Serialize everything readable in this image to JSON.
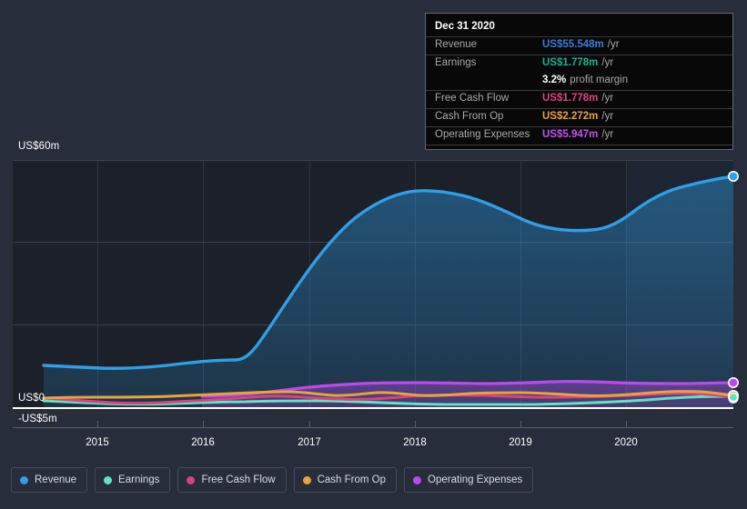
{
  "chart_data": {
    "type": "area",
    "title": "",
    "xlabel": "",
    "ylabel": "",
    "x_tick_labels": [
      "2015",
      "2016",
      "2017",
      "2018",
      "2019",
      "2020"
    ],
    "y_tick_labels": [
      "US$60m",
      "US$0",
      "-US$5m"
    ],
    "ylim": [
      -5,
      60
    ],
    "xlim": [
      2014.5,
      2021.0
    ],
    "grid": true,
    "legend_position": "bottom-left",
    "units": "US$ millions per year",
    "series": [
      {
        "name": "Revenue",
        "color": "#2e9fe8",
        "x": [
          2014.6,
          2014.9,
          2015.2,
          2015.5,
          2015.8,
          2016.0,
          2016.25,
          2016.5,
          2016.75,
          2017.0,
          2017.25,
          2017.5,
          2017.75,
          2018.0,
          2018.25,
          2018.5,
          2018.75,
          2019.0,
          2019.25,
          2019.5,
          2019.75,
          2020.0,
          2020.3,
          2020.6,
          2020.95
        ],
        "values": [
          9.6,
          9.3,
          9.0,
          9.2,
          9.6,
          10.0,
          10.4,
          10.5,
          14.5,
          22.5,
          31.0,
          38.5,
          44.0,
          47.0,
          46.3,
          45.6,
          43.4,
          40.0,
          37.4,
          37.2,
          39.3,
          44.6,
          48.0,
          49.6,
          52.6
        ]
      },
      {
        "name": "Earnings",
        "color": "#5fe3c0",
        "x": [
          2014.6,
          2015.0,
          2015.4,
          2015.8,
          2016.2,
          2016.6,
          2017.0,
          2017.4,
          2017.8,
          2018.2,
          2018.6,
          2019.0,
          2019.4,
          2019.8,
          2020.2,
          2020.6,
          2020.95
        ],
        "values": [
          -0.55,
          -0.75,
          -0.9,
          -0.95,
          -0.9,
          -0.75,
          -0.7,
          -0.85,
          -0.9,
          -0.85,
          -0.95,
          -1.0,
          -0.95,
          -0.8,
          -0.3,
          0.4,
          0.8
        ]
      },
      {
        "name": "Free Cash Flow",
        "color": "#d6447f",
        "x": [
          2014.6,
          2015.0,
          2015.4,
          2015.8,
          2016.2,
          2016.6,
          2017.0,
          2017.4,
          2017.8,
          2018.2,
          2018.6,
          2019.0,
          2019.4,
          2019.8,
          2020.2,
          2020.6,
          2020.95
        ],
        "values": [
          0.3,
          0.1,
          -0.55,
          -0.75,
          -0.55,
          -0.3,
          0.1,
          0.55,
          0.4,
          0.1,
          0.9,
          1.1,
          0.9,
          0.7,
          1.0,
          1.5,
          1.1
        ]
      },
      {
        "name": "Cash From Op",
        "color": "#e8a33d",
        "x": [
          2014.6,
          2015.0,
          2015.4,
          2015.8,
          2016.2,
          2016.6,
          2017.0,
          2017.4,
          2017.8,
          2018.2,
          2018.6,
          2019.0,
          2019.4,
          2019.8,
          2020.2,
          2020.6,
          2020.95
        ],
        "values": [
          0.45,
          0.6,
          0.55,
          0.5,
          0.75,
          0.95,
          1.35,
          0.8,
          1.3,
          0.7,
          1.15,
          1.2,
          0.85,
          0.8,
          1.2,
          1.7,
          1.5
        ]
      },
      {
        "name": "Operating Expenses",
        "color": "#bb4aea",
        "x": [
          2015.95,
          2016.3,
          2016.7,
          2017.1,
          2017.5,
          2017.9,
          2018.3,
          2018.7,
          2019.1,
          2019.5,
          2019.9,
          2020.3,
          2020.7,
          2020.95
        ],
        "values": [
          1.6,
          1.65,
          2.3,
          3.1,
          3.4,
          3.7,
          4.0,
          3.8,
          3.75,
          4.2,
          3.95,
          3.95,
          4.1,
          4.2
        ]
      }
    ],
    "end_markers": [
      {
        "series": "Revenue",
        "value": 55.548
      },
      {
        "series": "Operating Expenses",
        "value": 5.947
      },
      {
        "series": "Cash From Op",
        "value": 2.272
      },
      {
        "series": "Free Cash Flow",
        "value": 1.778
      },
      {
        "series": "Earnings",
        "value": 1.778
      }
    ]
  },
  "tooltip": {
    "date": "Dec 31 2020",
    "rows": [
      {
        "key": "Revenue",
        "value": "US$55.548m",
        "unit": "/yr",
        "color": "#3b7ddd",
        "rule": true
      },
      {
        "key": "Earnings",
        "value": "US$1.778m",
        "unit": "/yr",
        "color": "#19b394",
        "rule": true
      },
      {
        "key": "",
        "value": "3.2%",
        "unit": "profit margin",
        "color": "#ffffff",
        "rule": false
      },
      {
        "key": "Free Cash Flow",
        "value": "US$1.778m",
        "unit": "/yr",
        "color": "#e0447f",
        "rule": true
      },
      {
        "key": "Cash From Op",
        "value": "US$2.272m",
        "unit": "/yr",
        "color": "#e8a33d",
        "rule": true
      },
      {
        "key": "Operating Expenses",
        "value": "US$5.947m",
        "unit": "/yr",
        "color": "#c452f0",
        "rule": true
      }
    ]
  },
  "legend": {
    "items": [
      {
        "label": "Revenue",
        "color": "#2e9fe8"
      },
      {
        "label": "Earnings",
        "color": "#5fe3c0"
      },
      {
        "label": "Free Cash Flow",
        "color": "#d6447f"
      },
      {
        "label": "Cash From Op",
        "color": "#e8a33d"
      },
      {
        "label": "Operating Expenses",
        "color": "#bb4aea"
      }
    ]
  },
  "axes": {
    "y_top": "US$60m",
    "y_zero": "US$0",
    "y_neg": "-US$5m",
    "x_ticks": [
      "2015",
      "2016",
      "2017",
      "2018",
      "2019",
      "2020"
    ]
  },
  "colors": {
    "background": "#272d3a",
    "plot_background": "#1b2029",
    "gridline": "#3b4250",
    "baseline": "#ffffff"
  }
}
